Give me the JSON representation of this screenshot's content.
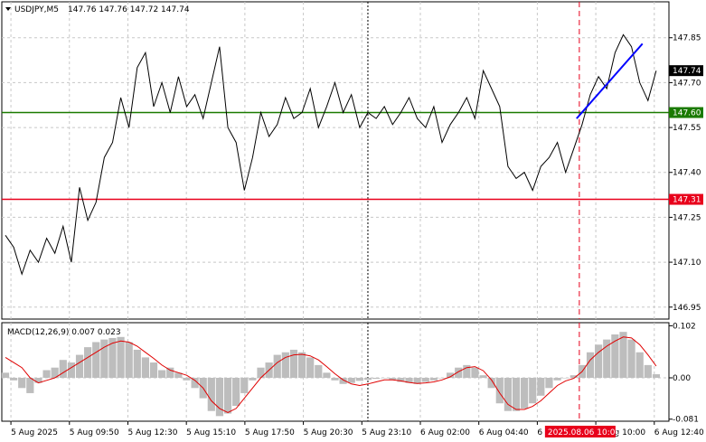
{
  "title": {
    "symbol": "USDJPY,M5",
    "ohlc": "147.76 147.76 147.72 147.74"
  },
  "macd_title": "MACD(12,26,9) 0.007 0.023",
  "colors": {
    "grid": "#c8c8c8",
    "price": "#000000",
    "support": "#1a7a00",
    "resistance": "#e8001b",
    "trend": "#0000ff",
    "histogram": "#bdbdbd",
    "signal": "#e00000",
    "current_tag": "#000000",
    "time_marker": "#e8001b"
  },
  "chart_data": [
    {
      "type": "line",
      "name": "price",
      "ylim": [
        146.91,
        147.97
      ],
      "yticks": [
        "147.85",
        "147.70",
        "147.55",
        "147.40",
        "147.25",
        "147.10",
        "146.95"
      ],
      "x_labels": [
        "5 Aug 2025",
        "5 Aug 09:50",
        "5 Aug 12:30",
        "5 Aug 15:10",
        "5 Aug 17:50",
        "5 Aug 20:30",
        "5 Aug 23:10",
        "6 Aug 02:00",
        "6 Aug 04:40",
        "6 Aug 07:20",
        "6 Aug 10:00",
        "6 Aug 12:40"
      ],
      "x_count": 240,
      "x": [
        0,
        3,
        6,
        9,
        12,
        15,
        18,
        21,
        24,
        27,
        30,
        33,
        36,
        39,
        42,
        45,
        48,
        51,
        54,
        57,
        60,
        63,
        66,
        69,
        72,
        75,
        78,
        81,
        84,
        87,
        90,
        93,
        96,
        99,
        102,
        105,
        108,
        111,
        114,
        117,
        120,
        123,
        126,
        129,
        132,
        135,
        138,
        141,
        144,
        147,
        150,
        153,
        156,
        159,
        162,
        165,
        168,
        171,
        174,
        177,
        180,
        183,
        186,
        189,
        192,
        195,
        198,
        201,
        204,
        207,
        210,
        213,
        216,
        219,
        222,
        225,
        228,
        231,
        234,
        237
      ],
      "values": [
        147.19,
        147.15,
        147.06,
        147.14,
        147.1,
        147.18,
        147.13,
        147.22,
        147.1,
        147.35,
        147.24,
        147.3,
        147.45,
        147.5,
        147.65,
        147.55,
        147.75,
        147.8,
        147.62,
        147.7,
        147.6,
        147.72,
        147.62,
        147.66,
        147.58,
        147.7,
        147.82,
        147.55,
        147.5,
        147.34,
        147.45,
        147.6,
        147.52,
        147.56,
        147.65,
        147.58,
        147.6,
        147.68,
        147.55,
        147.62,
        147.7,
        147.6,
        147.66,
        147.55,
        147.6,
        147.58,
        147.62,
        147.56,
        147.6,
        147.65,
        147.58,
        147.55,
        147.62,
        147.5,
        147.56,
        147.6,
        147.65,
        147.58,
        147.74,
        147.68,
        147.62,
        147.42,
        147.38,
        147.4,
        147.34,
        147.42,
        147.45,
        147.5,
        147.4,
        147.48,
        147.56,
        147.66,
        147.72,
        147.68,
        147.8,
        147.86,
        147.82,
        147.7,
        147.64,
        147.74
      ]
    },
    {
      "type": "line",
      "name": "price_levels",
      "support": "147.60",
      "resistance": "147.31",
      "current": "147.74",
      "trend_start": [
        208,
        147.58
      ],
      "trend_end": [
        232,
        147.83
      ],
      "dashed_marker_index": 132,
      "red_marker_index": 209,
      "marker_label": "2025.08.06 10:00"
    },
    {
      "type": "bar",
      "name": "macd",
      "ylim": [
        -0.085,
        0.108
      ],
      "yticks": [
        "0.102",
        "0.00",
        "-0.081"
      ],
      "x": [
        0,
        3,
        6,
        9,
        12,
        15,
        18,
        21,
        24,
        27,
        30,
        33,
        36,
        39,
        42,
        45,
        48,
        51,
        54,
        57,
        60,
        63,
        66,
        69,
        72,
        75,
        78,
        81,
        84,
        87,
        90,
        93,
        96,
        99,
        102,
        105,
        108,
        111,
        114,
        117,
        120,
        123,
        126,
        129,
        132,
        135,
        138,
        141,
        144,
        147,
        150,
        153,
        156,
        159,
        162,
        165,
        168,
        171,
        174,
        177,
        180,
        183,
        186,
        189,
        192,
        195,
        198,
        201,
        204,
        207,
        210,
        213,
        216,
        219,
        222,
        225,
        228,
        231,
        234,
        237
      ],
      "histogram": [
        0.01,
        -0.005,
        -0.02,
        -0.03,
        -0.01,
        0.015,
        0.02,
        0.035,
        0.03,
        0.045,
        0.06,
        0.07,
        0.075,
        0.078,
        0.08,
        0.07,
        0.055,
        0.04,
        0.03,
        0.015,
        0.02,
        0.01,
        -0.005,
        -0.02,
        -0.04,
        -0.065,
        -0.075,
        -0.07,
        -0.055,
        -0.03,
        -0.005,
        0.02,
        0.03,
        0.045,
        0.05,
        0.055,
        0.05,
        0.04,
        0.025,
        0.01,
        -0.005,
        -0.012,
        -0.01,
        -0.006,
        -0.004,
        -0.002,
        0.0,
        -0.004,
        -0.008,
        -0.01,
        -0.012,
        -0.008,
        -0.005,
        0.0,
        0.01,
        0.02,
        0.025,
        0.02,
        0.005,
        -0.02,
        -0.05,
        -0.065,
        -0.065,
        -0.06,
        -0.05,
        -0.035,
        -0.02,
        -0.005,
        0.0,
        0.005,
        0.025,
        0.05,
        0.065,
        0.075,
        0.085,
        0.09,
        0.075,
        0.05,
        0.025,
        0.007
      ],
      "signal": [
        0.04,
        0.03,
        0.02,
        0.0,
        -0.01,
        -0.005,
        0.0,
        0.01,
        0.02,
        0.03,
        0.04,
        0.05,
        0.06,
        0.068,
        0.072,
        0.07,
        0.062,
        0.05,
        0.038,
        0.025,
        0.015,
        0.01,
        0.005,
        -0.005,
        -0.02,
        -0.045,
        -0.06,
        -0.068,
        -0.06,
        -0.04,
        -0.02,
        0.0,
        0.015,
        0.03,
        0.04,
        0.045,
        0.046,
        0.043,
        0.035,
        0.022,
        0.008,
        -0.004,
        -0.012,
        -0.015,
        -0.012,
        -0.008,
        -0.004,
        -0.004,
        -0.006,
        -0.009,
        -0.011,
        -0.01,
        -0.008,
        -0.004,
        0.002,
        0.012,
        0.02,
        0.022,
        0.014,
        -0.004,
        -0.03,
        -0.052,
        -0.062,
        -0.062,
        -0.056,
        -0.045,
        -0.03,
        -0.015,
        -0.006,
        -0.001,
        0.012,
        0.035,
        0.05,
        0.062,
        0.072,
        0.08,
        0.078,
        0.065,
        0.045,
        0.023
      ]
    }
  ]
}
